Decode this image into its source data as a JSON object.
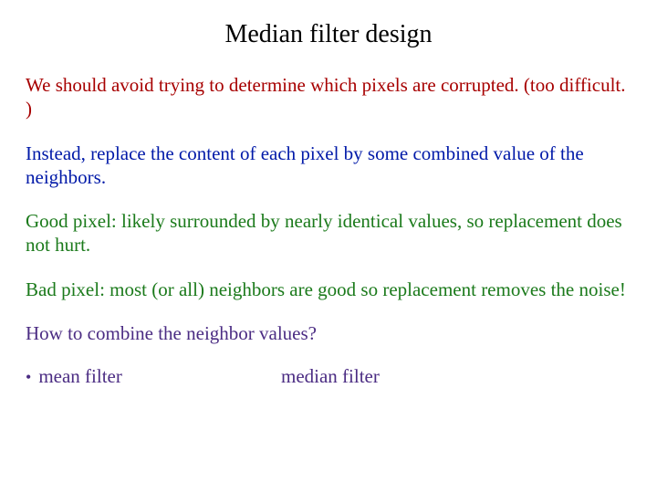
{
  "title": "Median filter design",
  "paragraphs": {
    "p1": "We should avoid trying to determine which pixels are corrupted. (too difficult. )",
    "p2": "Instead, replace the content of each pixel by some combined value of the neighbors.",
    "p3": "Good pixel: likely surrounded by nearly identical values, so replacement does not hurt.",
    "p4": "Bad pixel: most (or all) neighbors are good so replacement removes the noise!",
    "p5": "How to combine the neighbor values?"
  },
  "bullets": {
    "b1": "mean filter",
    "b2": "median filter"
  }
}
